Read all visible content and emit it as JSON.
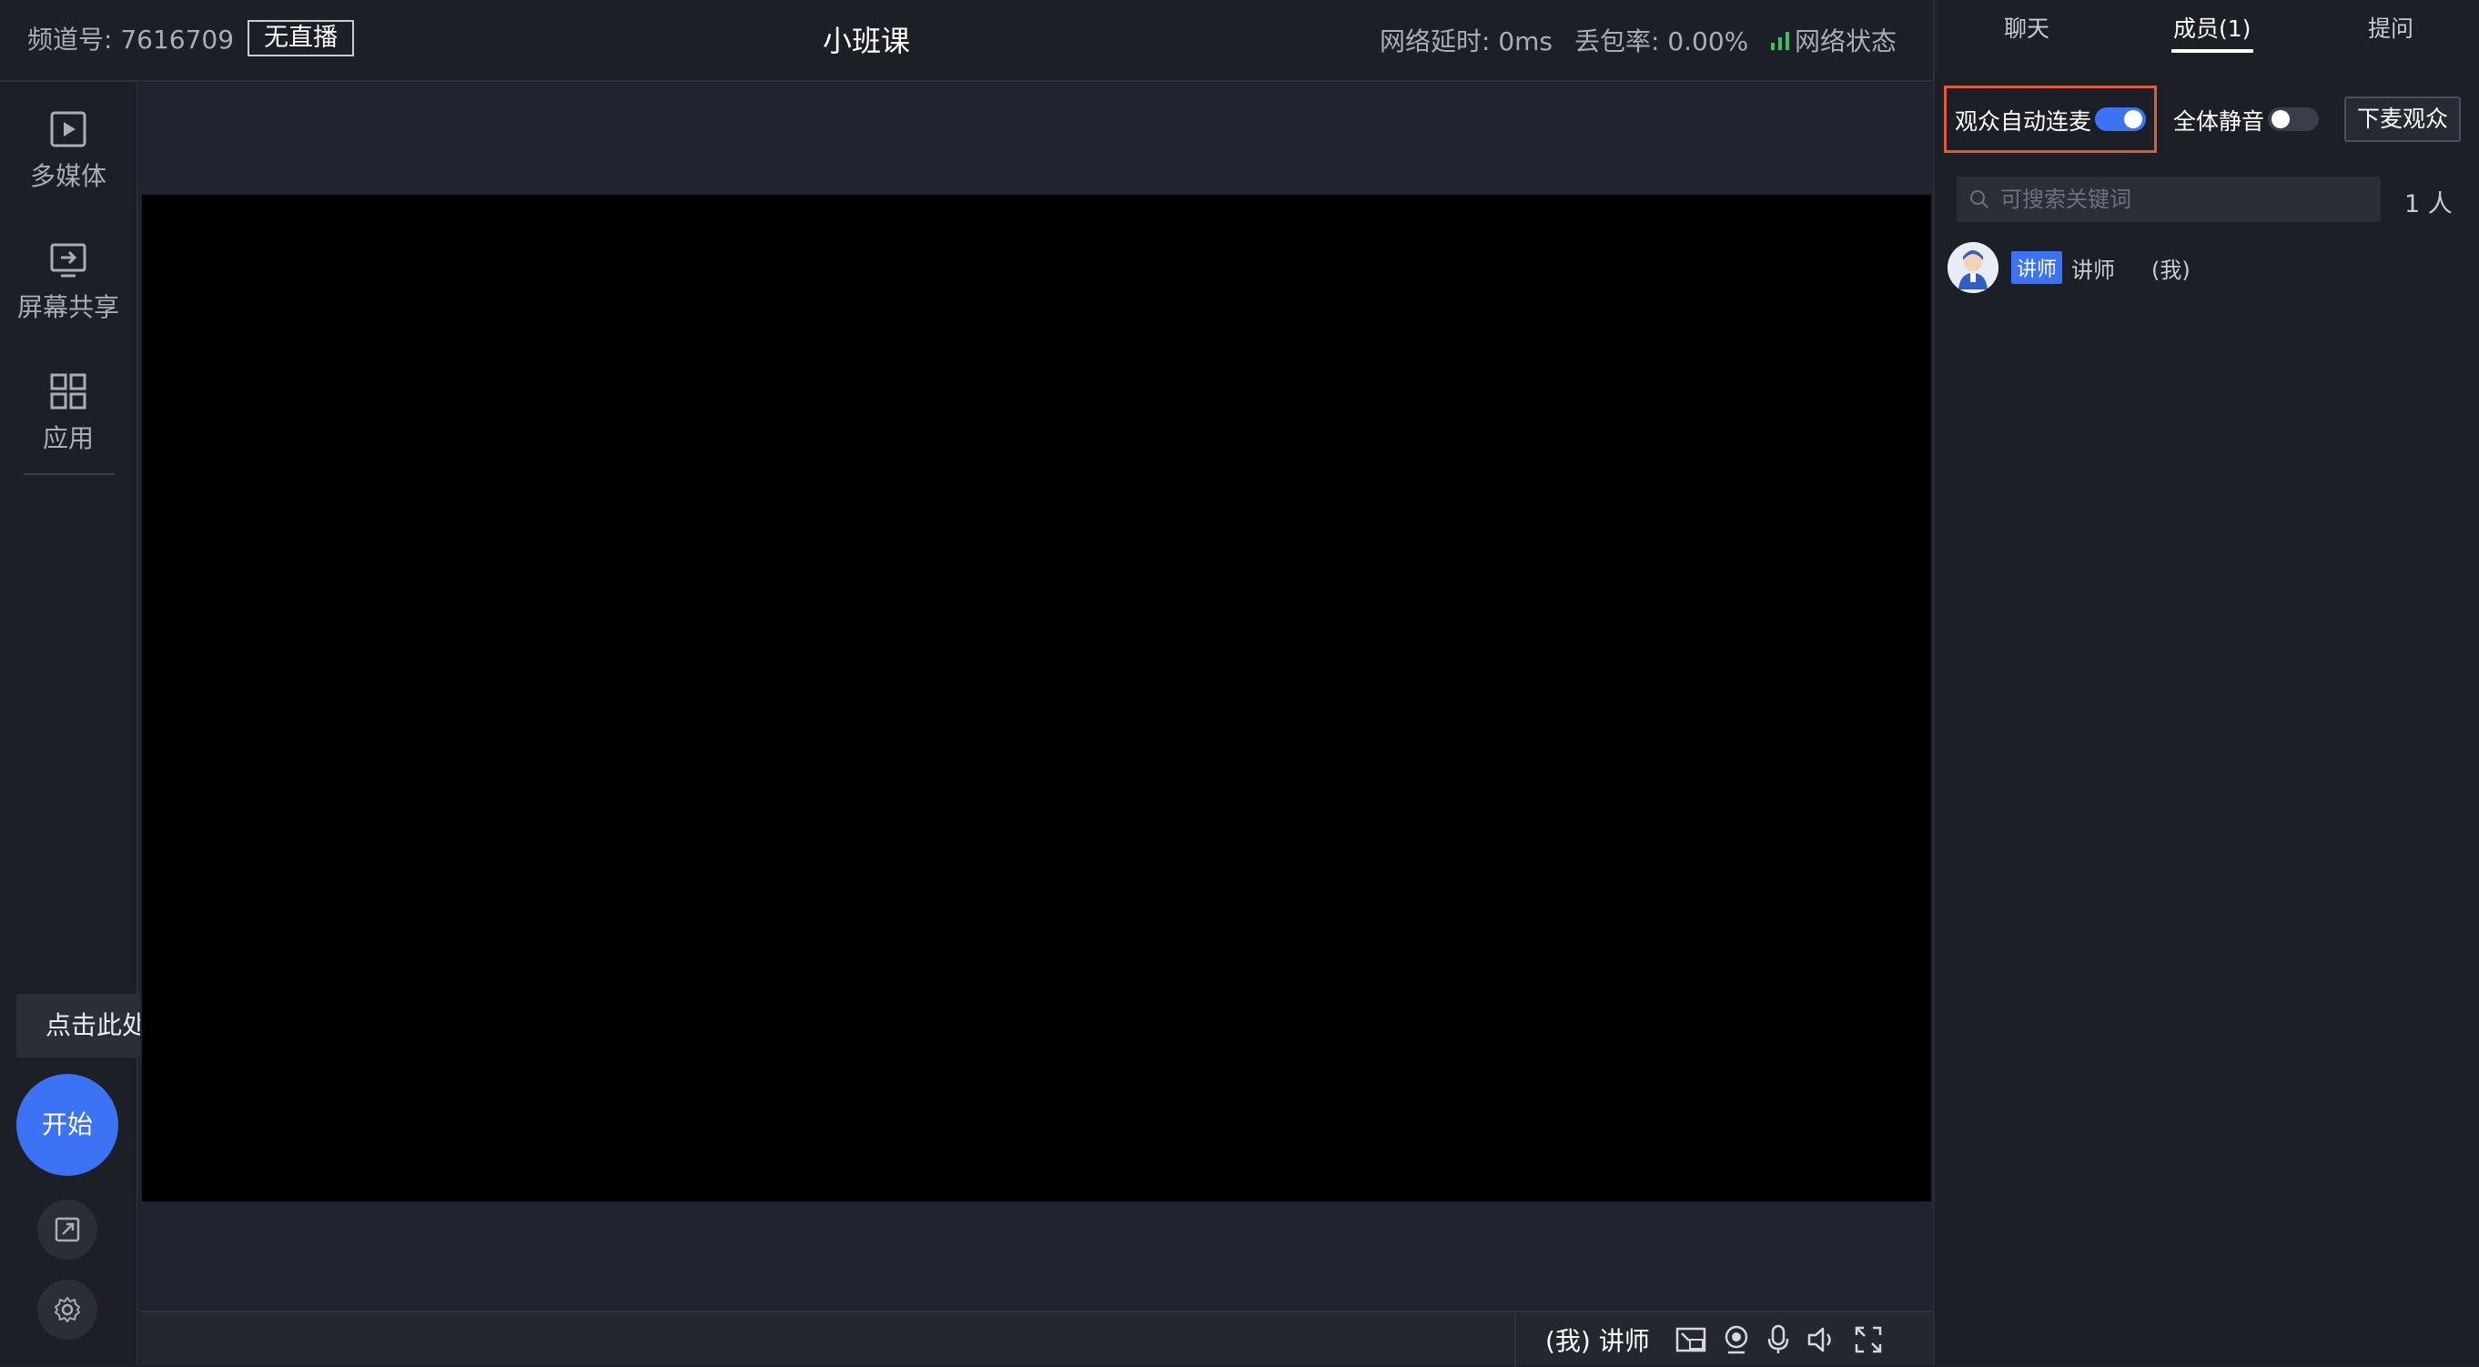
{
  "header": {
    "channel": "频道号: 7616709",
    "live_status": "无直播",
    "title": "小班课",
    "latency": "网络延时: 0ms",
    "packet_loss": "丢包率: 0.00%",
    "network_status": "网络状态",
    "network_color": "#3fbf5a"
  },
  "sidebar": {
    "items": [
      {
        "label": "多媒体",
        "icon": "play-icon"
      },
      {
        "label": "屏幕共享",
        "icon": "screen-share-icon"
      },
      {
        "label": "应用",
        "icon": "grid-icon"
      }
    ],
    "tooltip": "点击此处可开始直播",
    "start_label": "开始",
    "accent": "#3c73f5"
  },
  "bottom": {
    "user_label": "(我) 讲师",
    "controls": [
      "pip-icon",
      "camera-icon",
      "mic-icon",
      "speaker-icon",
      "fullscreen-icon"
    ]
  },
  "right_panel": {
    "tabs": [
      {
        "label": "聊天",
        "active": false
      },
      {
        "label": "成员(1)",
        "active": true
      },
      {
        "label": "提问",
        "active": false
      }
    ],
    "auto_mic_label": "观众自动连麦",
    "auto_mic_on": true,
    "mute_all_label": "全体静音",
    "mute_all_on": false,
    "down_button": "下麦观众",
    "search_placeholder": "可搜索关键词",
    "count": "1 人",
    "members": [
      {
        "role": "讲师",
        "name": "讲师",
        "me": "(我)"
      }
    ]
  }
}
